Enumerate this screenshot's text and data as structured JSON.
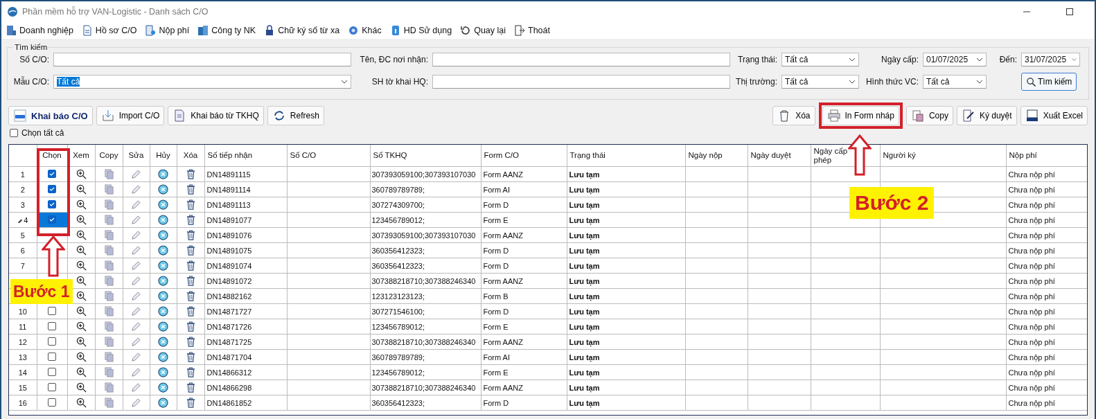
{
  "window": {
    "title": "Phần mềm hỗ trợ VAN-Logistic - Danh sách C/O"
  },
  "menu": [
    {
      "label": "Doanh nghiệp"
    },
    {
      "label": "Hồ sơ C/O"
    },
    {
      "label": "Nộp phí"
    },
    {
      "label": "Công ty NK"
    },
    {
      "label": "Chữ ký số từ xa"
    },
    {
      "label": "Khác"
    },
    {
      "label": "HD Sử dụng"
    },
    {
      "label": "Quay lại"
    },
    {
      "label": "Thoát"
    }
  ],
  "search": {
    "legend": "Tìm kiếm",
    "rows": [
      [
        {
          "label": "Số C/O:",
          "kind": "text"
        },
        {
          "label": "Tên, ĐC nơi nhận:",
          "kind": "text"
        },
        {
          "label": "Trạng thái:",
          "kind": "select",
          "value": "Tất cả"
        },
        {
          "label": "Ngày cấp:",
          "kind": "date",
          "value": "01/07/2025"
        },
        {
          "label": "Đến:",
          "kind": "date",
          "value": "31/07/2025"
        }
      ],
      [
        {
          "label": "Mẫu C/O:",
          "kind": "select",
          "value": "Tất cả",
          "value_highlighted": true
        },
        {
          "label": "SH tờ khai HQ:",
          "kind": "text"
        },
        {
          "label": "Thị trường:",
          "kind": "select",
          "value": "Tất cả"
        },
        {
          "label": "Hình thức VC:",
          "kind": "select",
          "value": "Tất cả"
        }
      ]
    ],
    "button": "Tìm kiếm"
  },
  "toolbar_left": [
    {
      "label": "Khai báo C/O",
      "primary": true
    },
    {
      "label": "Import C/O",
      "primary": false
    },
    {
      "label": "Khai báo từ TKHQ",
      "primary": false
    },
    {
      "label": "Refresh",
      "primary": false
    }
  ],
  "toolbar_right": [
    {
      "label": "Xóa"
    },
    {
      "label": "In Form nháp"
    },
    {
      "label": "Copy"
    },
    {
      "label": "Ký duyệt"
    },
    {
      "label": "Xuất Excel"
    }
  ],
  "select_all": {
    "label": "Chọn tất cả",
    "checked": false
  },
  "table": {
    "columns": [
      "Chọn",
      "Xem",
      "Copy",
      "Sửa",
      "Hủy",
      "Xóa",
      "Số tiếp nhận",
      "Số C/O",
      "Số TKHQ",
      "Form C/O",
      "Trạng thái",
      "Ngày nộp",
      "Ngày duyệt",
      "Ngày cấp phép",
      "Người ký",
      "Nộp phí"
    ],
    "rows": [
      {
        "number": "1",
        "checked": true,
        "selected": false,
        "editing": false,
        "so_tiep_nhan": "DN14891115",
        "so_tkhq": "307393059100;307393107030",
        "form": "Form AANZ",
        "trang_thai": "Lưu tạm",
        "nop_phi": "Chưa nộp phí"
      },
      {
        "number": "2",
        "checked": true,
        "selected": false,
        "editing": false,
        "so_tiep_nhan": "DN14891114",
        "so_tkhq": "360789789789;",
        "form": "Form AI",
        "trang_thai": "Lưu tạm",
        "nop_phi": "Chưa nộp phí"
      },
      {
        "number": "3",
        "checked": true,
        "selected": false,
        "editing": false,
        "so_tiep_nhan": "DN14891113",
        "so_tkhq": "307274309700;",
        "form": "Form D",
        "trang_thai": "Lưu tạm",
        "nop_phi": "Chưa nộp phí"
      },
      {
        "number": "4",
        "checked": true,
        "selected": true,
        "editing": true,
        "so_tiep_nhan": "DN14891077",
        "so_tkhq": "123456789012;",
        "form": "Form E",
        "trang_thai": "Lưu tạm",
        "nop_phi": "Chưa nộp phí"
      },
      {
        "number": "5",
        "selected": false,
        "editing": false,
        "so_tiep_nhan": "DN14891076",
        "so_tkhq": "307393059100;307393107030",
        "form": "Form AANZ",
        "trang_thai": "Lưu tạm",
        "nop_phi": "Chưa nộp phí"
      },
      {
        "number": "6",
        "selected": false,
        "editing": false,
        "so_tiep_nhan": "DN14891075",
        "so_tkhq": "360356412323;",
        "form": "Form D",
        "trang_thai": "Lưu tạm",
        "nop_phi": "Chưa nộp phí"
      },
      {
        "number": "7",
        "selected": false,
        "editing": false,
        "so_tiep_nhan": "DN14891074",
        "so_tkhq": "360356412323;",
        "form": "Form D",
        "trang_thai": "Lưu tạm",
        "nop_phi": "Chưa nộp phí"
      },
      {
        "selected": false,
        "editing": false,
        "so_tiep_nhan": "DN14891072",
        "so_tkhq": "307388218710;307388246340",
        "form": "Form AANZ",
        "trang_thai": "Lưu tạm",
        "nop_phi": "Chưa nộp phí"
      },
      {
        "selected": false,
        "editing": false,
        "so_tiep_nhan": "DN14882162",
        "so_tkhq": "123123123123;",
        "form": "Form B",
        "trang_thai": "Lưu tạm",
        "nop_phi": "Chưa nộp phí"
      },
      {
        "number": "10",
        "checked": false,
        "selected": false,
        "editing": false,
        "so_tiep_nhan": "DN14871727",
        "so_tkhq": "307271546100;",
        "form": "Form D",
        "trang_thai": "Lưu tạm",
        "nop_phi": "Chưa nộp phí"
      },
      {
        "number": "11",
        "checked": false,
        "selected": false,
        "editing": false,
        "so_tiep_nhan": "DN14871726",
        "so_tkhq": "123456789012;",
        "form": "Form E",
        "trang_thai": "Lưu tạm",
        "nop_phi": "Chưa nộp phí"
      },
      {
        "number": "12",
        "checked": false,
        "selected": false,
        "editing": false,
        "so_tiep_nhan": "DN14871725",
        "so_tkhq": "307388218710;307388246340",
        "form": "Form AANZ",
        "trang_thai": "Lưu tạm",
        "nop_phi": "Chưa nộp phí"
      },
      {
        "number": "13",
        "checked": false,
        "selected": false,
        "editing": false,
        "so_tiep_nhan": "DN14871704",
        "so_tkhq": "360789789789;",
        "form": "Form AI",
        "trang_thai": "Lưu tạm",
        "nop_phi": "Chưa nộp phí"
      },
      {
        "number": "14",
        "checked": false,
        "selected": false,
        "editing": false,
        "so_tiep_nhan": "DN14866312",
        "so_tkhq": "123456789012;",
        "form": "Form E",
        "trang_thai": "Lưu tạm",
        "nop_phi": "Chưa nộp phí"
      },
      {
        "number": "15",
        "checked": false,
        "selected": false,
        "editing": false,
        "so_tiep_nhan": "DN14866298",
        "so_tkhq": "307388218710;307388246340",
        "form": "Form AANZ",
        "trang_thai": "Lưu tạm",
        "nop_phi": "Chưa nộp phí"
      },
      {
        "number": "16",
        "checked": false,
        "selected": false,
        "editing": false,
        "so_tiep_nhan": "DN14861852",
        "so_tkhq": "360356412323;",
        "form": "Form D",
        "trang_thai": "Lưu tạm",
        "nop_phi": "Chưa nộp phí"
      }
    ]
  },
  "annotations": [
    {
      "kind": "step",
      "text": "Bước 1"
    },
    {
      "kind": "step",
      "text": "Bước 2"
    }
  ]
}
